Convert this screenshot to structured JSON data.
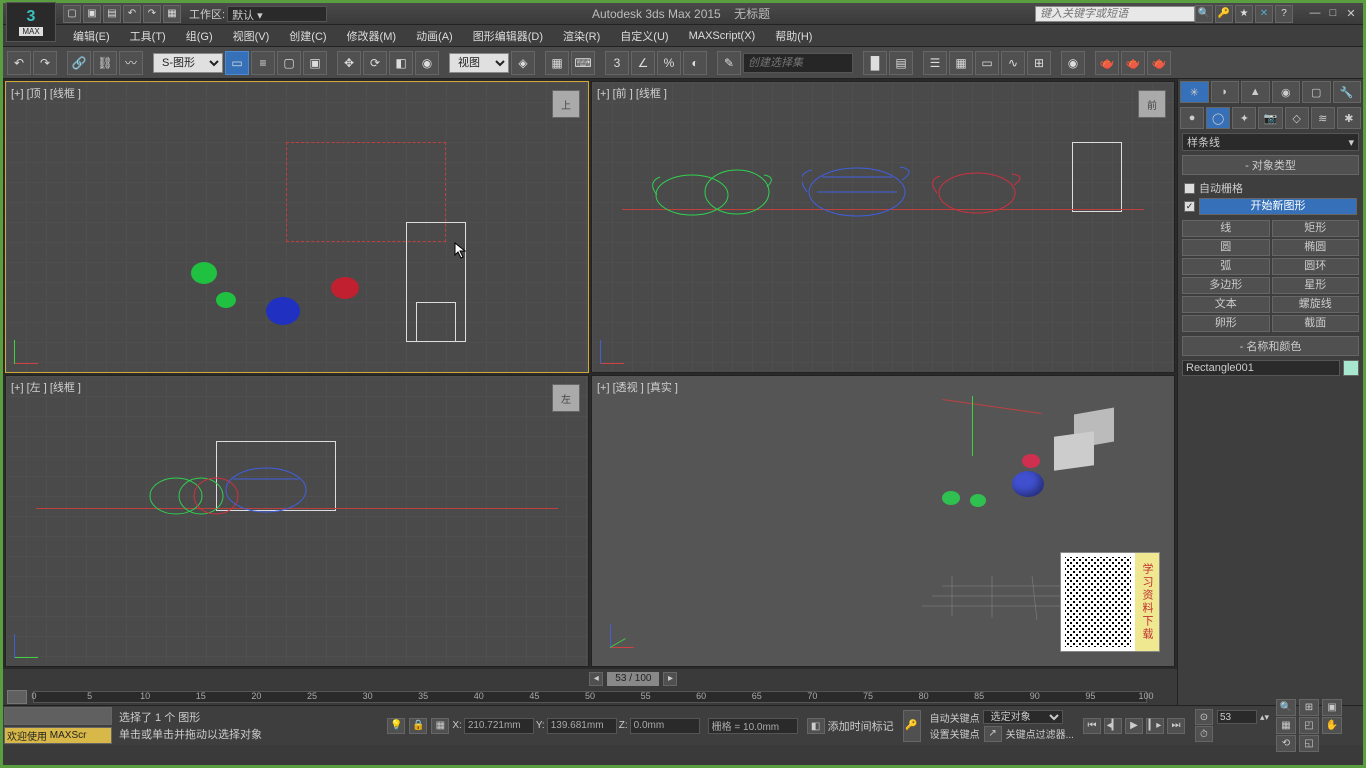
{
  "title": {
    "app": "Autodesk 3ds Max  2015",
    "doc": "无标题",
    "workspace_label": "工作区:",
    "workspace_value": "默认",
    "search_placeholder": "键入关键字或短语"
  },
  "menu": {
    "edit": "编辑(E)",
    "tools": "工具(T)",
    "group": "组(G)",
    "views": "视图(V)",
    "create": "创建(C)",
    "modifiers": "修改器(M)",
    "animation": "动画(A)",
    "graph": "图形编辑器(D)",
    "rendering": "渲染(R)",
    "customize": "自定义(U)",
    "maxscript": "MAXScript(X)",
    "help": "帮助(H)"
  },
  "toolbar": {
    "sel_filter": "S-图形",
    "ref_coord": "视图",
    "named_sel": "创建选择集",
    "three": "3"
  },
  "viewports": {
    "top": "[+] [顶 ] [线框 ]",
    "front": "[+] [前 ] [线框 ]",
    "left": "[+] [左 ] [线框 ]",
    "persp": "[+] [透视 ] [真实 ]",
    "cube_top": "上",
    "cube_front": "前",
    "cube_left": "左"
  },
  "cmdpanel": {
    "dropdown": "样条线",
    "rollout_type": "对象类型",
    "autogrid": "自动栅格",
    "start_new_shape": "开始新图形",
    "btns": {
      "line": "线",
      "rect": "矩形",
      "circle": "圆",
      "ellipse": "椭圆",
      "arc": "弧",
      "donut": "圆环",
      "ngon": "多边形",
      "star": "星形",
      "text": "文本",
      "helix": "螺旋线",
      "egg": "卵形",
      "section": "截面"
    },
    "rollout_name": "名称和颜色",
    "obj_name": "Rectangle001"
  },
  "timeslider": {
    "value": "53 / 100"
  },
  "timeline": {
    "ticks": [
      "0",
      "5",
      "10",
      "15",
      "20",
      "25",
      "30",
      "35",
      "40",
      "45",
      "50",
      "55",
      "60",
      "65",
      "70",
      "75",
      "80",
      "85",
      "90",
      "95",
      "100"
    ]
  },
  "status": {
    "btn1": "欢迎使用",
    "btn2": "MAXScr",
    "line1": "选择了 1 个 图形",
    "line2": "单击或单击并拖动以选择对象",
    "x": "X:",
    "xv": "210.721mm",
    "y": "Y:",
    "yv": "139.681mm",
    "z": "Z:",
    "zv": "0.0mm",
    "grid": "栅格 = 10.0mm",
    "addtime": "添加时间标记",
    "autokey": "自动关键点",
    "setkey": "设置关键点",
    "sel_combo": "选定对象",
    "filter": "关键点过滤器...",
    "frame": "53"
  },
  "qr": {
    "side": "学习资料下载"
  }
}
